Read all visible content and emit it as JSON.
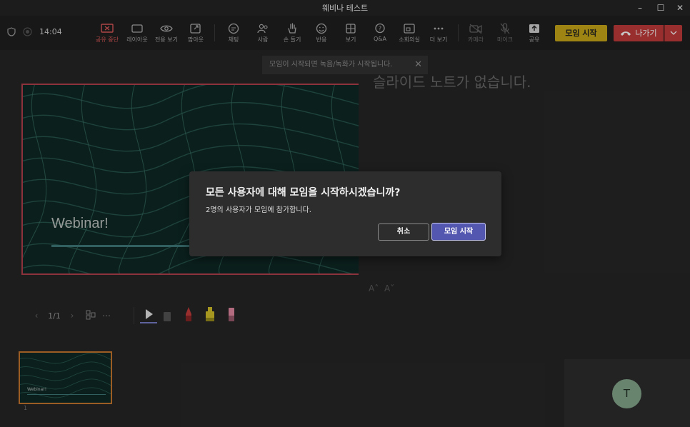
{
  "window": {
    "title": "웨비나 테스트"
  },
  "status": {
    "time": "14:04"
  },
  "toolbar": {
    "tools": [
      {
        "id": "stop-sharing",
        "label": "공유 중단",
        "icon": "present-stop-icon"
      },
      {
        "id": "layout",
        "label": "레이아웃",
        "icon": "layout-icon"
      },
      {
        "id": "presenter-view",
        "label": "전용 보기",
        "icon": "eye-icon"
      },
      {
        "id": "popout",
        "label": "팝아웃",
        "icon": "popout-icon"
      },
      {
        "id": "chat",
        "label": "채팅",
        "icon": "chat-icon"
      },
      {
        "id": "people",
        "label": "사람",
        "icon": "people-icon"
      },
      {
        "id": "raise-hand",
        "label": "손 들기",
        "icon": "hand-icon"
      },
      {
        "id": "reactions",
        "label": "반응",
        "icon": "smile-icon"
      },
      {
        "id": "view",
        "label": "보기",
        "icon": "grid-icon"
      },
      {
        "id": "qna",
        "label": "Q&A",
        "icon": "qna-icon"
      },
      {
        "id": "breakout",
        "label": "소회의실",
        "icon": "breakout-icon"
      },
      {
        "id": "more",
        "label": "더 보기",
        "icon": "more-icon"
      },
      {
        "id": "camera",
        "label": "카메라",
        "icon": "camera-off-icon"
      },
      {
        "id": "mic",
        "label": "마이크",
        "icon": "mic-off-icon"
      },
      {
        "id": "share",
        "label": "공유",
        "icon": "share-icon"
      }
    ],
    "start_label": "모임 시작",
    "leave_label": "나가기"
  },
  "notice": {
    "text": "모임이 시작되면 녹음/녹화가 시작됩니다."
  },
  "presenter": {
    "notes_empty": "슬라이드 노트가 없습니다.",
    "font_increase": "A˄",
    "font_decrease": "A˅"
  },
  "slide": {
    "title": "Webinar!"
  },
  "navigation": {
    "page": "1/1"
  },
  "thumbnail": {
    "title": "Webinar!",
    "number": "1"
  },
  "participant": {
    "initial": "T"
  },
  "dialog": {
    "title": "모든 사용자에 대해 모임을 시작하시겠습니까?",
    "subtitle": "2명의 사용자가 모임에 참가합니다.",
    "cancel_label": "취소",
    "start_label": "모임 시작"
  },
  "colors": {
    "accent_start": "#c9a919",
    "leave": "#c43b3b",
    "primary_button": "#5457b0",
    "slide_border": "#b3404f",
    "thumb_border": "#c7782f"
  }
}
